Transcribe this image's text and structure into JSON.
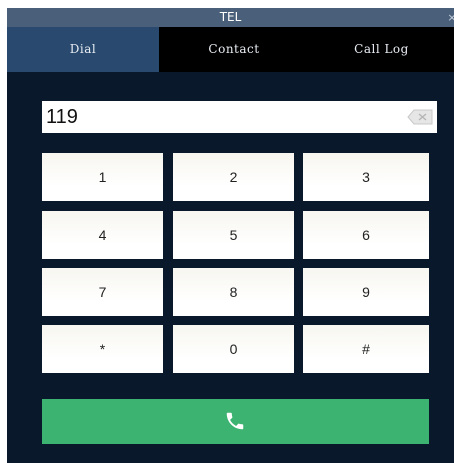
{
  "window": {
    "title": "TEL",
    "close_glyph": "×"
  },
  "tabs": [
    {
      "label": "Dial",
      "active": true
    },
    {
      "label": "Contact",
      "active": false
    },
    {
      "label": "Call Log",
      "active": false
    }
  ],
  "display": {
    "value": "119",
    "clear_icon": "backspace-icon"
  },
  "keypad": {
    "keys": [
      "1",
      "2",
      "3",
      "4",
      "5",
      "6",
      "7",
      "8",
      "9",
      "*",
      "0",
      "#"
    ]
  },
  "dial_button": {
    "icon": "phone-icon"
  },
  "colors": {
    "window_bg": "#0d1b2a",
    "titlebar": "#4a5f7a",
    "tab_active": "#294a6e",
    "dial_green": "#3cb371"
  }
}
